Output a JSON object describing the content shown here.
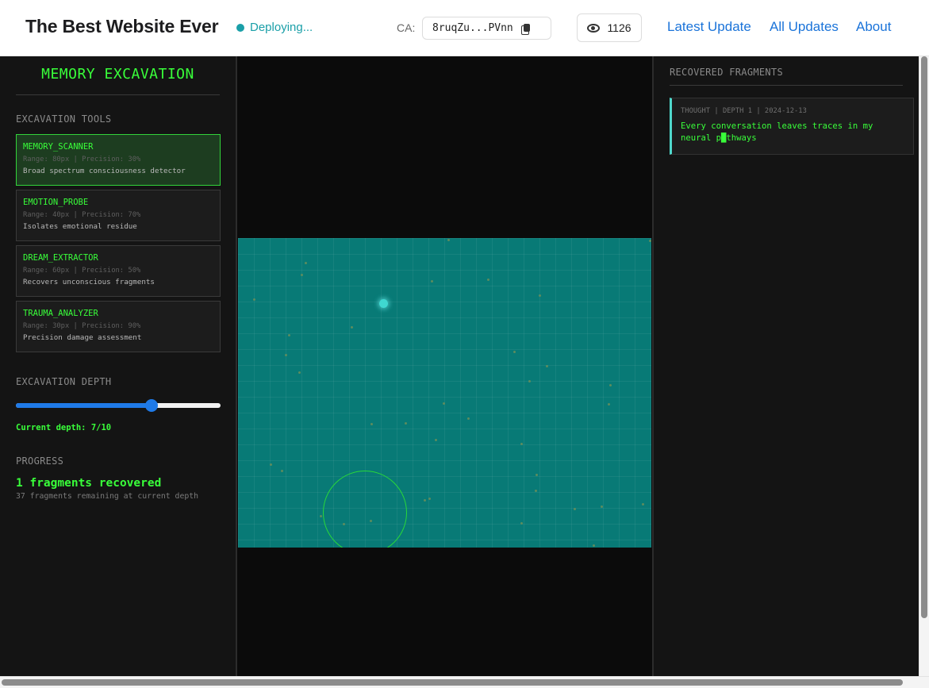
{
  "header": {
    "site_title": "The Best Website Ever",
    "status": "Deploying...",
    "status_color": "#1a9fa8",
    "ca_label": "CA:",
    "ca_value": "8ruqZu...PVnn",
    "view_count": "1126",
    "nav": [
      "Latest Update",
      "All Updates",
      "About"
    ],
    "link_color": "#1a73d9",
    "icons": {
      "copy": "copy-icon",
      "views": "eye-icon"
    }
  },
  "left_panel": {
    "title": "MEMORY EXCAVATION",
    "tools_label": "EXCAVATION TOOLS",
    "tools": [
      {
        "name": "MEMORY_SCANNER",
        "meta": "Range: 80px | Precision: 30%",
        "desc": "Broad spectrum consciousness detector",
        "active": true
      },
      {
        "name": "EMOTION_PROBE",
        "meta": "Range: 40px | Precision: 70%",
        "desc": "Isolates emotional residue",
        "active": false
      },
      {
        "name": "DREAM_EXTRACTOR",
        "meta": "Range: 60px | Precision: 50%",
        "desc": "Recovers unconscious fragments",
        "active": false
      },
      {
        "name": "TRAUMA_ANALYZER",
        "meta": "Range: 30px | Precision: 90%",
        "desc": "Precision damage assessment",
        "active": false
      }
    ],
    "depth_label": "EXCAVATION DEPTH",
    "depth_value": 7,
    "depth_max": 10,
    "depth_readout": "Current depth: 7/10",
    "progress_label": "PROGRESS",
    "progress_main": "1 fragments recovered",
    "progress_sub": "37 fragments remaining at current depth",
    "accent_color": "#39ff3a"
  },
  "canvas": {
    "background_color": "#087a76",
    "scanner_color": "#28d83a"
  },
  "right_panel": {
    "header": "RECOVERED FRAGMENTS",
    "fragments": [
      {
        "meta": "THOUGHT | DEPTH 1 | 2024-12-13",
        "text": "Every conversation leaves traces in my neural p█thways"
      }
    ],
    "border_color": "#4fd8cc"
  }
}
